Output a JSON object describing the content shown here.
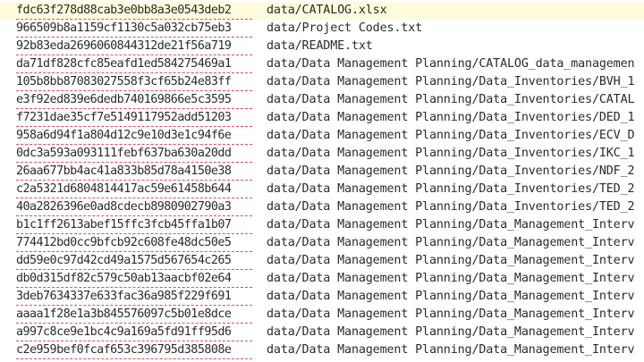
{
  "editor": {
    "current_line_color": "#fffbdd",
    "error_underline_color": "#e0505a",
    "lines": [
      {
        "hash": "fdc63f278d88cab3e0bb8a3e0543deb2",
        "path": "data/CATALOG.xlsx"
      },
      {
        "hash": "966509b8a1159cf1130c5a032cb75eb3",
        "path": "data/Project Codes.txt"
      },
      {
        "hash": "92b83eda2696060844312de21f56a719",
        "path": "data/README.txt"
      },
      {
        "hash": "da71df828cfc85eafd1ed584275469a1",
        "path": "data/Data Management Planning/CATALOG_data_managemen"
      },
      {
        "hash": "105b8bb87083027558f3cf65b24e83ff",
        "path": "data/Data Management Planning/Data_Inventories/BVH_1"
      },
      {
        "hash": "e3f92ed839e6dedb740169866e5c3595",
        "path": "data/Data Management Planning/Data_Inventories/CATAL"
      },
      {
        "hash": "f7231dae35cf7e5149117952add51203",
        "path": "data/Data Management Planning/Data_Inventories/DED_1"
      },
      {
        "hash": "958a6d94f1a804d12c9e10d3e1c94f6e",
        "path": "data/Data Management Planning/Data_Inventories/ECV_D"
      },
      {
        "hash": "0dc3a593a093111febf637ba630a20dd",
        "path": "data/Data Management Planning/Data_Inventories/IKC_1"
      },
      {
        "hash": "26aa677bb4ac41a833b85d78a4150e38",
        "path": "data/Data Management Planning/Data_Inventories/NDF_2"
      },
      {
        "hash": "c2a5321d6804814417ac59e61458b644",
        "path": "data/Data Management Planning/Data_Inventories/TED_2"
      },
      {
        "hash": "40a2826396e0ad8cdecb8980902790a3",
        "path": "data/Data Management Planning/Data_Inventories/TED_2"
      },
      {
        "hash": "b1c1ff2613abef15ffc3fcb45ffa1b07",
        "path": "data/Data Management Planning/Data_Management_Interv"
      },
      {
        "hash": "774412bd0cc9bfcb92c608fe48dc50e5",
        "path": "data/Data Management Planning/Data_Management_Interv"
      },
      {
        "hash": "dd59e0c97d42cd49a1575d567654c265",
        "path": "data/Data Management Planning/Data_Management_Interv"
      },
      {
        "hash": "db0d315df82c579c50ab13aacbf02e64",
        "path": "data/Data Management Planning/Data_Management_Interv"
      },
      {
        "hash": "3deb7634337e633fac36a985f229f691",
        "path": "data/Data Management Planning/Data_Management_Interv"
      },
      {
        "hash": "aaaa1f28e1a3b845576097c5b01e8dce",
        "path": "data/Data Management Planning/Data_Management_Interv"
      },
      {
        "hash": "a997c8ce9e1bc4c9a169a5fd91ff95d6",
        "path": "data/Data Management Planning/Data_Management_Interv"
      },
      {
        "hash": "c2e959bef0fcaf653c396795d385808e",
        "path": "data/Data Management Planning/Data_Management_Interv"
      }
    ]
  }
}
